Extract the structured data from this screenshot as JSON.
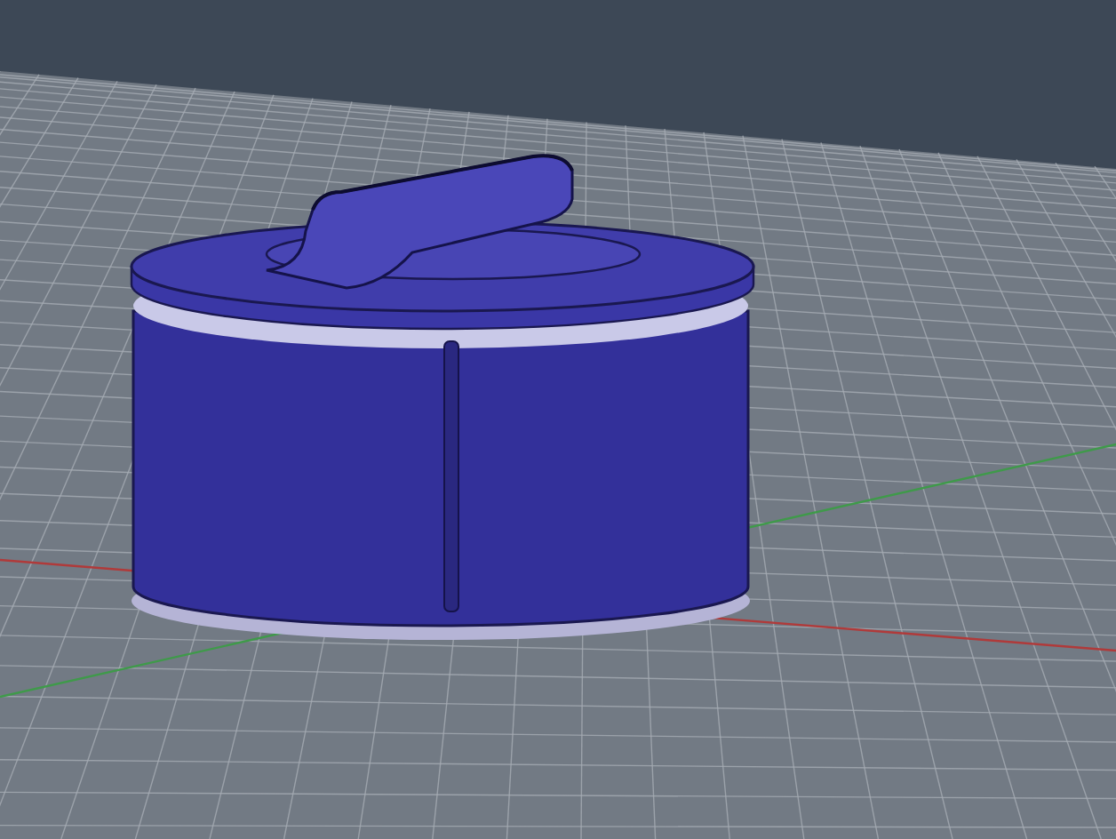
{
  "viewport": {
    "axes": [
      {
        "kind": "x",
        "color": "#b03a3a"
      },
      {
        "kind": "y",
        "color": "#3f9a4a"
      }
    ]
  }
}
